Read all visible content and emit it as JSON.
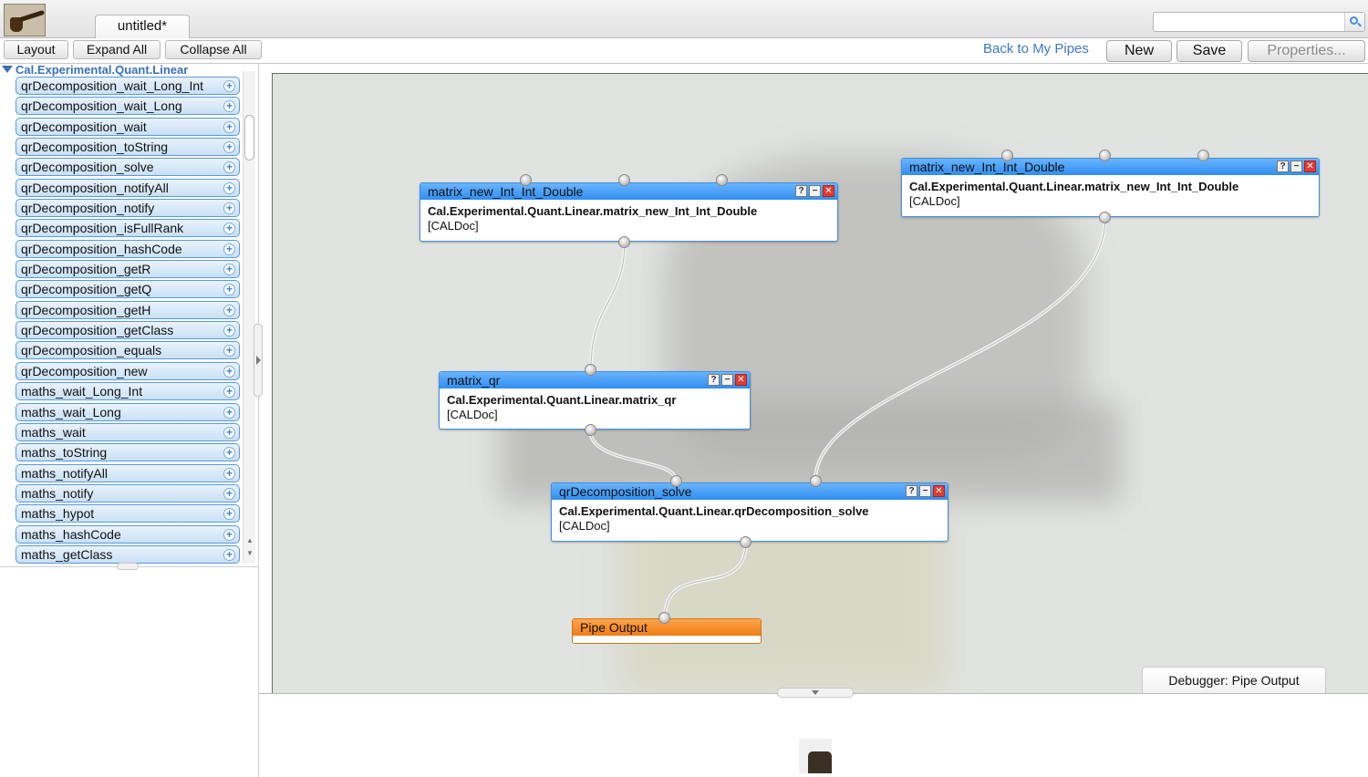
{
  "app": {
    "tab_title": "untitled*",
    "search_placeholder": ""
  },
  "toolbar": {
    "layout_label": "Layout",
    "expand_all_label": "Expand All",
    "collapse_all_label": "Collapse All",
    "back_link": "Back to My Pipes",
    "new_label": "New",
    "save_label": "Save",
    "properties_label": "Properties..."
  },
  "sidebar": {
    "tree_header": "Cal.Experimental.Quant.Linear",
    "items": [
      "qrDecomposition_wait_Long_Int",
      "qrDecomposition_wait_Long",
      "qrDecomposition_wait",
      "qrDecomposition_toString",
      "qrDecomposition_solve",
      "qrDecomposition_notifyAll",
      "qrDecomposition_notify",
      "qrDecomposition_isFullRank",
      "qrDecomposition_hashCode",
      "qrDecomposition_getR",
      "qrDecomposition_getQ",
      "qrDecomposition_getH",
      "qrDecomposition_getClass",
      "qrDecomposition_equals",
      "qrDecomposition_new",
      "maths_wait_Long_Int",
      "maths_wait_Long",
      "maths_wait",
      "maths_toString",
      "maths_notifyAll",
      "maths_notify",
      "maths_hypot",
      "maths_hashCode",
      "maths_getClass"
    ]
  },
  "modules": {
    "m1": {
      "title": "matrix_new_Int_Int_Double",
      "full": "Cal.Experimental.Quant.Linear.matrix_new_Int_Int_Double",
      "doc": "[CALDoc]"
    },
    "m2": {
      "title": "matrix_new_Int_Int_Double",
      "full": "Cal.Experimental.Quant.Linear.matrix_new_Int_Int_Double",
      "doc": "[CALDoc]"
    },
    "m3": {
      "title": "matrix_qr",
      "full": "Cal.Experimental.Quant.Linear.matrix_qr",
      "doc": "[CALDoc]"
    },
    "m4": {
      "title": "qrDecomposition_solve",
      "full": "Cal.Experimental.Quant.Linear.qrDecomposition_solve",
      "doc": "[CALDoc]"
    },
    "output": {
      "title": "Pipe Output"
    },
    "button_glyphs": {
      "help": "?",
      "minimize": "−",
      "close": "✕"
    }
  },
  "debugger": {
    "tab_label": "Debugger: Pipe Output"
  },
  "colors": {
    "accent_blue": "#2f8ef0",
    "output_orange": "#f07c12",
    "link_blue": "#3e78c8"
  }
}
